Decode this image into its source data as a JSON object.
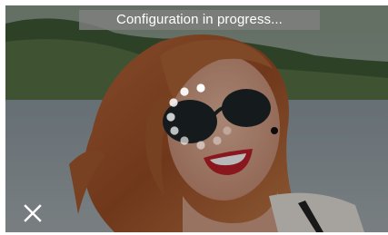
{
  "status": {
    "message": "Configuration in progress..."
  },
  "controls": {
    "close_icon": "close-icon",
    "spinner_icon": "loading-spinner-icon"
  },
  "colors": {
    "banner_bg": "#8a8a8a",
    "banner_text": "#ffffff",
    "icon": "#ffffff"
  }
}
